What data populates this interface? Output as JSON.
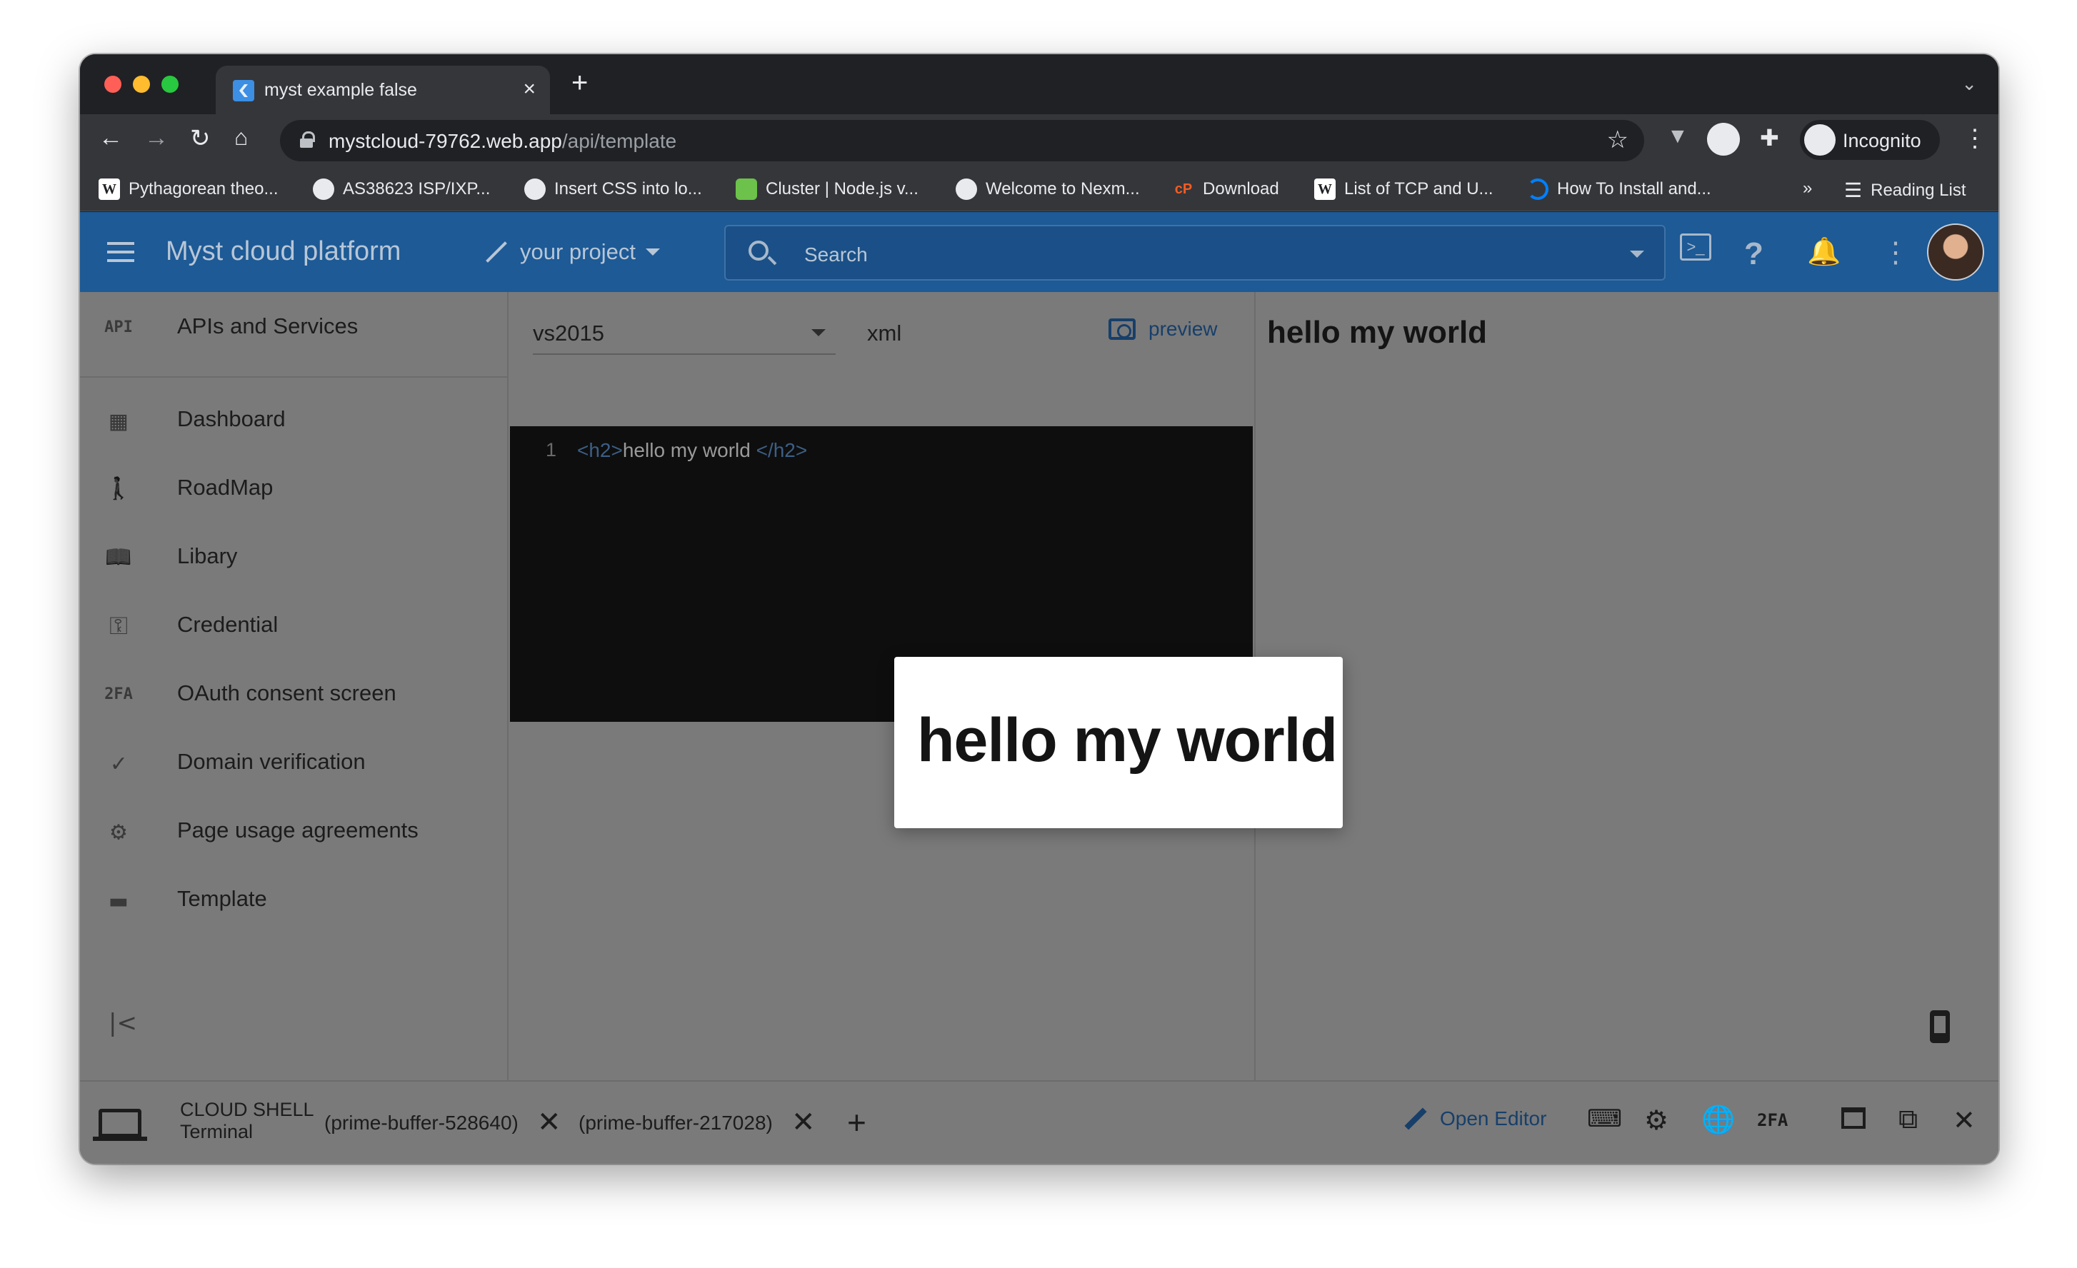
{
  "browser": {
    "tab_title": "myst example false",
    "tab_close": "×",
    "new_tab": "+",
    "tab_menu": "⌄",
    "url_host": "mystcloud-79762.web.app",
    "url_path": "/api/template",
    "profile_label": "Incognito"
  },
  "bookmarks": [
    {
      "label": "Pythagorean theo...",
      "icon": "W"
    },
    {
      "label": "AS38623 ISP/IXP...",
      "icon": ""
    },
    {
      "label": "Insert CSS into lo...",
      "icon": ""
    },
    {
      "label": "Cluster | Node.js v...",
      "icon": ""
    },
    {
      "label": "Welcome to Nexm...",
      "icon": ""
    },
    {
      "label": "Download",
      "icon": "cP"
    },
    {
      "label": "List of TCP and U...",
      "icon": "W"
    },
    {
      "label": "How To Install and...",
      "icon": ""
    }
  ],
  "bookmarks_more": "»",
  "reading_list": "Reading List",
  "appbar": {
    "brand": "Myst cloud platform",
    "project": "your project",
    "search_placeholder": "Search",
    "help": "?",
    "more": "⋮"
  },
  "sidebar": {
    "items": [
      {
        "icon": "API",
        "label": "APIs and Services"
      },
      {
        "icon": "▦",
        "label": "Dashboard"
      },
      {
        "icon": "🚶",
        "label": "RoadMap"
      },
      {
        "icon": "📖",
        "label": "Libary"
      },
      {
        "icon": "⚿",
        "label": "Credential"
      },
      {
        "icon": "2FA",
        "label": "OAuth consent screen"
      },
      {
        "icon": "✓",
        "label": "Domain verification"
      },
      {
        "icon": "⚙",
        "label": "Page usage agreements"
      },
      {
        "icon": "▬",
        "label": "Template"
      }
    ],
    "collapse": "|<"
  },
  "editor": {
    "theme": "vs2015",
    "language": "xml",
    "preview_label": "preview",
    "line_number": "1",
    "code_open_tag": "<h2>",
    "code_text": "hello my world ",
    "code_close_tag": "</h2>"
  },
  "preview": {
    "heading": "hello my world"
  },
  "modal": {
    "heading": "hello my world"
  },
  "cloudshell": {
    "title_line1": "CLOUD SHELL",
    "title_line2": "Terminal",
    "tabs": [
      "(prime-buffer-528640)",
      "(prime-buffer-217028)"
    ],
    "close_glyph": "✕",
    "add_glyph": "+",
    "open_editor": "Open Editor",
    "twofa": "2FA"
  },
  "colors": {
    "appbar": "#1d5a96",
    "overlay_bg": "#7a7a7a",
    "accent_link": "#173f6a"
  }
}
